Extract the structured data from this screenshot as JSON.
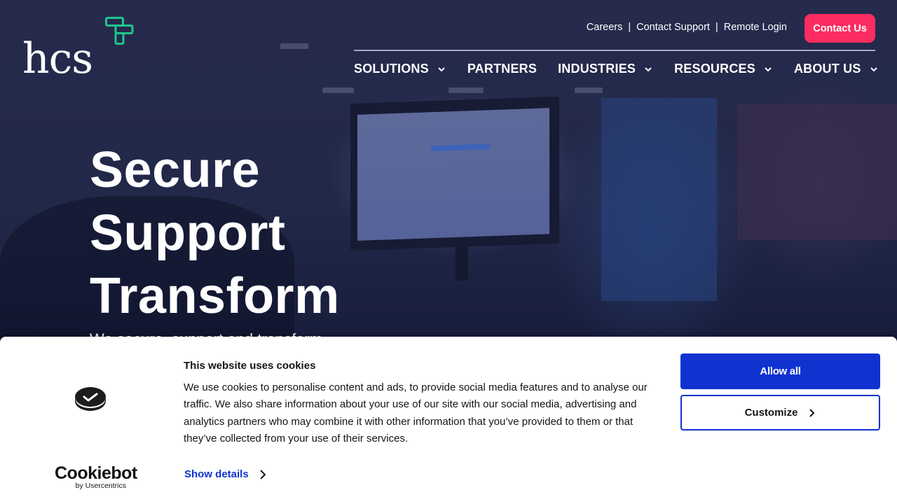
{
  "brand": {
    "logo_text": "hcs",
    "accent_green": "#1fc68a",
    "accent_pink": "#fb2d60"
  },
  "utility_nav": {
    "links": [
      "Careers",
      "Contact Support",
      "Remote Login"
    ],
    "separator": "|",
    "cta_label": "Contact Us"
  },
  "main_nav": {
    "items": [
      {
        "label": "SOLUTIONS",
        "has_dropdown": true
      },
      {
        "label": "PARTNERS",
        "has_dropdown": false
      },
      {
        "label": "INDUSTRIES",
        "has_dropdown": true
      },
      {
        "label": "RESOURCES",
        "has_dropdown": true
      },
      {
        "label": "ABOUT US",
        "has_dropdown": true
      }
    ]
  },
  "hero": {
    "title_lines": [
      "Secure",
      "Support",
      "Transform"
    ],
    "subtitle_partial": "We secure, support and transform"
  },
  "cookie_banner": {
    "brand_name": "Cookiebot",
    "brand_by": "by Usercentrics",
    "title": "This website uses cookies",
    "text": "We use cookies to personalise content and ads, to provide social media features and to analyse our traffic. We also share information about your use of our site with our social media, advertising and analytics partners who may combine it with other information that you’ve provided to them or that they’ve collected from your use of their services.",
    "show_details_label": "Show details",
    "allow_all_label": "Allow all",
    "customize_label": "Customize",
    "primary_color": "#1032cf"
  }
}
